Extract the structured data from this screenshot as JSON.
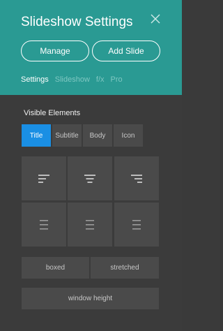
{
  "panel": {
    "title": "Slideshow Settings",
    "close_icon": "close-icon"
  },
  "actions": {
    "manage_label": "Manage",
    "add_slide_label": "Add Slide"
  },
  "tabs": [
    {
      "label": "Settings",
      "active": true
    },
    {
      "label": "Slideshow",
      "active": false
    },
    {
      "label": "f/x",
      "active": false
    },
    {
      "label": "Pro",
      "active": false
    }
  ],
  "visible_elements": {
    "label": "Visible Elements",
    "options": [
      {
        "label": "Title",
        "active": true
      },
      {
        "label": "Subtitle",
        "active": false
      },
      {
        "label": "Body",
        "active": false
      },
      {
        "label": "Icon",
        "active": false
      }
    ]
  },
  "alignment": {
    "icons": [
      "align-top-left-icon",
      "align-top-center-icon",
      "align-top-right-icon",
      "align-middle-left-icon",
      "align-middle-center-icon",
      "align-middle-right-icon"
    ]
  },
  "layout": {
    "boxed_label": "boxed",
    "stretched_label": "stretched",
    "window_height_label": "window height"
  },
  "colors": {
    "header": "#2a9a93",
    "panel": "#3b3b3b",
    "button": "#4a4a4a",
    "active_blue": "#1a8fe4"
  }
}
